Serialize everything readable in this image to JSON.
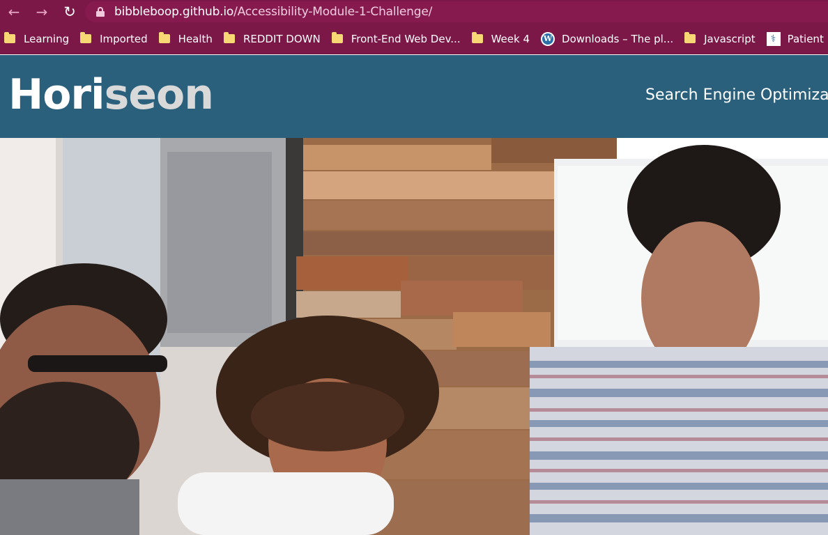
{
  "browser": {
    "url_domain": "bibbleboop.github.io",
    "url_path": "/Accessibility-Module-1-Challenge/",
    "back_icon": "←",
    "forward_icon": "→",
    "reload_icon": "↻"
  },
  "bookmarks": [
    {
      "label": "Learning",
      "icon": "folder-icon"
    },
    {
      "label": "Imported",
      "icon": "folder-icon"
    },
    {
      "label": "Health",
      "icon": "folder-icon"
    },
    {
      "label": "REDDIT DOWN",
      "icon": "folder-icon"
    },
    {
      "label": "Front-End Web Dev...",
      "icon": "folder-icon"
    },
    {
      "label": "Week 4",
      "icon": "folder-icon"
    },
    {
      "label": "Downloads – The pl...",
      "icon": "wordpress-icon"
    },
    {
      "label": "Javascript",
      "icon": "folder-icon"
    },
    {
      "label": "Patient Portal",
      "icon": "portal-icon"
    }
  ],
  "header": {
    "logo_part1": "Hori",
    "logo_part2": "seon",
    "nav_link": "Search Engine Optimization"
  },
  "colors": {
    "toolbar": "#7b1848",
    "header": "#2a607c",
    "logo_accent": "#d9d9d9"
  }
}
